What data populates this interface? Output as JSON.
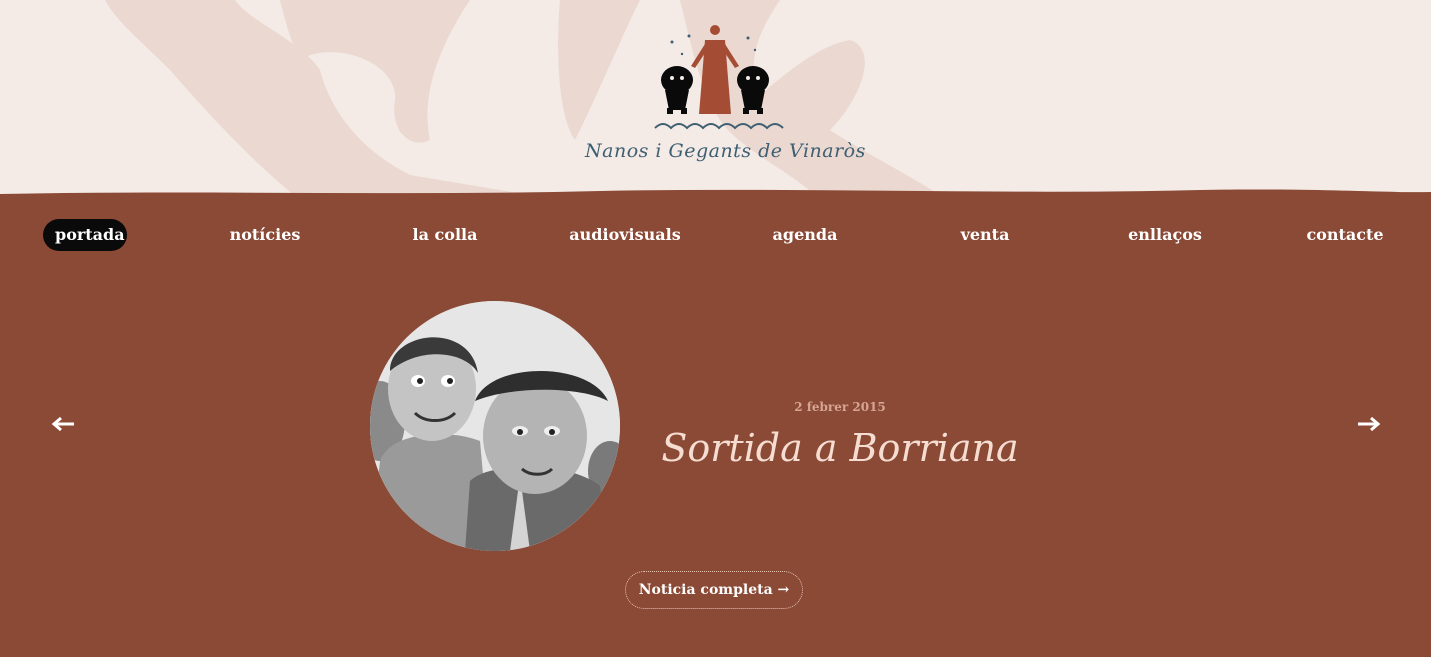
{
  "header": {
    "site_name": "Nanos i Gegants de Vinaròs",
    "colors": {
      "background": "#f4ebe7",
      "silhouette": "#ead8d1",
      "logo_text": "#3e5f72",
      "logo_figure": "#a54d34"
    }
  },
  "nav": {
    "items": [
      {
        "label": "portada",
        "active": true
      },
      {
        "label": "notícies"
      },
      {
        "label": "la colla"
      },
      {
        "label": "audiovisuals"
      },
      {
        "label": "agenda"
      },
      {
        "label": "venta"
      },
      {
        "label": "enllaços"
      },
      {
        "label": "contacte"
      }
    ]
  },
  "slide": {
    "date": "2 febrer 2015",
    "title": "Sortida a Borriana",
    "button_label": "Noticia completa →",
    "prev_icon": "arrow-left-icon",
    "next_icon": "arrow-right-icon"
  },
  "colors": {
    "main_background": "#8b4a36",
    "active_nav": "#0a0a0a",
    "title": "#f6ddd2",
    "date": "#d6a594"
  }
}
